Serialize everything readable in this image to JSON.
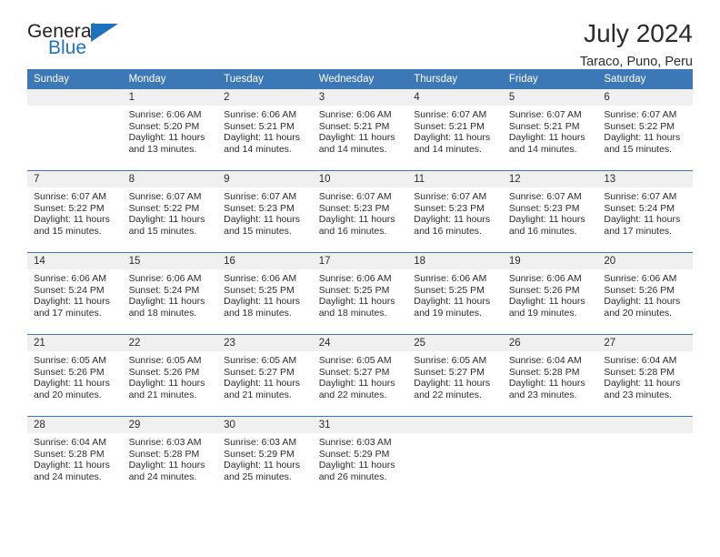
{
  "logo": {
    "word_top": "General",
    "word_bottom": "Blue",
    "accent_color": "#1e72bd"
  },
  "header": {
    "title": "July 2024",
    "subtitle": "Taraco, Puno, Peru"
  },
  "theme": {
    "header_blue": "#3c78b5",
    "daynum_bg": "#f0f0f0",
    "text": "#2b2b2b"
  },
  "calendar": {
    "weekday_headers": [
      "Sunday",
      "Monday",
      "Tuesday",
      "Wednesday",
      "Thursday",
      "Friday",
      "Saturday"
    ],
    "labels": {
      "sunrise": "Sunrise:",
      "sunset": "Sunset:",
      "daylight": "Daylight:"
    },
    "weeks": [
      [
        {
          "day": "",
          "sunrise": "",
          "sunset": "",
          "daylight_line1": "",
          "daylight_line2": ""
        },
        {
          "day": "1",
          "sunrise": "Sunrise: 6:06 AM",
          "sunset": "Sunset: 5:20 PM",
          "daylight_line1": "Daylight: 11 hours",
          "daylight_line2": "and 13 minutes."
        },
        {
          "day": "2",
          "sunrise": "Sunrise: 6:06 AM",
          "sunset": "Sunset: 5:21 PM",
          "daylight_line1": "Daylight: 11 hours",
          "daylight_line2": "and 14 minutes."
        },
        {
          "day": "3",
          "sunrise": "Sunrise: 6:06 AM",
          "sunset": "Sunset: 5:21 PM",
          "daylight_line1": "Daylight: 11 hours",
          "daylight_line2": "and 14 minutes."
        },
        {
          "day": "4",
          "sunrise": "Sunrise: 6:07 AM",
          "sunset": "Sunset: 5:21 PM",
          "daylight_line1": "Daylight: 11 hours",
          "daylight_line2": "and 14 minutes."
        },
        {
          "day": "5",
          "sunrise": "Sunrise: 6:07 AM",
          "sunset": "Sunset: 5:21 PM",
          "daylight_line1": "Daylight: 11 hours",
          "daylight_line2": "and 14 minutes."
        },
        {
          "day": "6",
          "sunrise": "Sunrise: 6:07 AM",
          "sunset": "Sunset: 5:22 PM",
          "daylight_line1": "Daylight: 11 hours",
          "daylight_line2": "and 15 minutes."
        }
      ],
      [
        {
          "day": "7",
          "sunrise": "Sunrise: 6:07 AM",
          "sunset": "Sunset: 5:22 PM",
          "daylight_line1": "Daylight: 11 hours",
          "daylight_line2": "and 15 minutes."
        },
        {
          "day": "8",
          "sunrise": "Sunrise: 6:07 AM",
          "sunset": "Sunset: 5:22 PM",
          "daylight_line1": "Daylight: 11 hours",
          "daylight_line2": "and 15 minutes."
        },
        {
          "day": "9",
          "sunrise": "Sunrise: 6:07 AM",
          "sunset": "Sunset: 5:23 PM",
          "daylight_line1": "Daylight: 11 hours",
          "daylight_line2": "and 15 minutes."
        },
        {
          "day": "10",
          "sunrise": "Sunrise: 6:07 AM",
          "sunset": "Sunset: 5:23 PM",
          "daylight_line1": "Daylight: 11 hours",
          "daylight_line2": "and 16 minutes."
        },
        {
          "day": "11",
          "sunrise": "Sunrise: 6:07 AM",
          "sunset": "Sunset: 5:23 PM",
          "daylight_line1": "Daylight: 11 hours",
          "daylight_line2": "and 16 minutes."
        },
        {
          "day": "12",
          "sunrise": "Sunrise: 6:07 AM",
          "sunset": "Sunset: 5:23 PM",
          "daylight_line1": "Daylight: 11 hours",
          "daylight_line2": "and 16 minutes."
        },
        {
          "day": "13",
          "sunrise": "Sunrise: 6:07 AM",
          "sunset": "Sunset: 5:24 PM",
          "daylight_line1": "Daylight: 11 hours",
          "daylight_line2": "and 17 minutes."
        }
      ],
      [
        {
          "day": "14",
          "sunrise": "Sunrise: 6:06 AM",
          "sunset": "Sunset: 5:24 PM",
          "daylight_line1": "Daylight: 11 hours",
          "daylight_line2": "and 17 minutes."
        },
        {
          "day": "15",
          "sunrise": "Sunrise: 6:06 AM",
          "sunset": "Sunset: 5:24 PM",
          "daylight_line1": "Daylight: 11 hours",
          "daylight_line2": "and 18 minutes."
        },
        {
          "day": "16",
          "sunrise": "Sunrise: 6:06 AM",
          "sunset": "Sunset: 5:25 PM",
          "daylight_line1": "Daylight: 11 hours",
          "daylight_line2": "and 18 minutes."
        },
        {
          "day": "17",
          "sunrise": "Sunrise: 6:06 AM",
          "sunset": "Sunset: 5:25 PM",
          "daylight_line1": "Daylight: 11 hours",
          "daylight_line2": "and 18 minutes."
        },
        {
          "day": "18",
          "sunrise": "Sunrise: 6:06 AM",
          "sunset": "Sunset: 5:25 PM",
          "daylight_line1": "Daylight: 11 hours",
          "daylight_line2": "and 19 minutes."
        },
        {
          "day": "19",
          "sunrise": "Sunrise: 6:06 AM",
          "sunset": "Sunset: 5:26 PM",
          "daylight_line1": "Daylight: 11 hours",
          "daylight_line2": "and 19 minutes."
        },
        {
          "day": "20",
          "sunrise": "Sunrise: 6:06 AM",
          "sunset": "Sunset: 5:26 PM",
          "daylight_line1": "Daylight: 11 hours",
          "daylight_line2": "and 20 minutes."
        }
      ],
      [
        {
          "day": "21",
          "sunrise": "Sunrise: 6:05 AM",
          "sunset": "Sunset: 5:26 PM",
          "daylight_line1": "Daylight: 11 hours",
          "daylight_line2": "and 20 minutes."
        },
        {
          "day": "22",
          "sunrise": "Sunrise: 6:05 AM",
          "sunset": "Sunset: 5:26 PM",
          "daylight_line1": "Daylight: 11 hours",
          "daylight_line2": "and 21 minutes."
        },
        {
          "day": "23",
          "sunrise": "Sunrise: 6:05 AM",
          "sunset": "Sunset: 5:27 PM",
          "daylight_line1": "Daylight: 11 hours",
          "daylight_line2": "and 21 minutes."
        },
        {
          "day": "24",
          "sunrise": "Sunrise: 6:05 AM",
          "sunset": "Sunset: 5:27 PM",
          "daylight_line1": "Daylight: 11 hours",
          "daylight_line2": "and 22 minutes."
        },
        {
          "day": "25",
          "sunrise": "Sunrise: 6:05 AM",
          "sunset": "Sunset: 5:27 PM",
          "daylight_line1": "Daylight: 11 hours",
          "daylight_line2": "and 22 minutes."
        },
        {
          "day": "26",
          "sunrise": "Sunrise: 6:04 AM",
          "sunset": "Sunset: 5:28 PM",
          "daylight_line1": "Daylight: 11 hours",
          "daylight_line2": "and 23 minutes."
        },
        {
          "day": "27",
          "sunrise": "Sunrise: 6:04 AM",
          "sunset": "Sunset: 5:28 PM",
          "daylight_line1": "Daylight: 11 hours",
          "daylight_line2": "and 23 minutes."
        }
      ],
      [
        {
          "day": "28",
          "sunrise": "Sunrise: 6:04 AM",
          "sunset": "Sunset: 5:28 PM",
          "daylight_line1": "Daylight: 11 hours",
          "daylight_line2": "and 24 minutes."
        },
        {
          "day": "29",
          "sunrise": "Sunrise: 6:03 AM",
          "sunset": "Sunset: 5:28 PM",
          "daylight_line1": "Daylight: 11 hours",
          "daylight_line2": "and 24 minutes."
        },
        {
          "day": "30",
          "sunrise": "Sunrise: 6:03 AM",
          "sunset": "Sunset: 5:29 PM",
          "daylight_line1": "Daylight: 11 hours",
          "daylight_line2": "and 25 minutes."
        },
        {
          "day": "31",
          "sunrise": "Sunrise: 6:03 AM",
          "sunset": "Sunset: 5:29 PM",
          "daylight_line1": "Daylight: 11 hours",
          "daylight_line2": "and 26 minutes."
        },
        {
          "day": "",
          "sunrise": "",
          "sunset": "",
          "daylight_line1": "",
          "daylight_line2": ""
        },
        {
          "day": "",
          "sunrise": "",
          "sunset": "",
          "daylight_line1": "",
          "daylight_line2": ""
        },
        {
          "day": "",
          "sunrise": "",
          "sunset": "",
          "daylight_line1": "",
          "daylight_line2": ""
        }
      ]
    ]
  }
}
